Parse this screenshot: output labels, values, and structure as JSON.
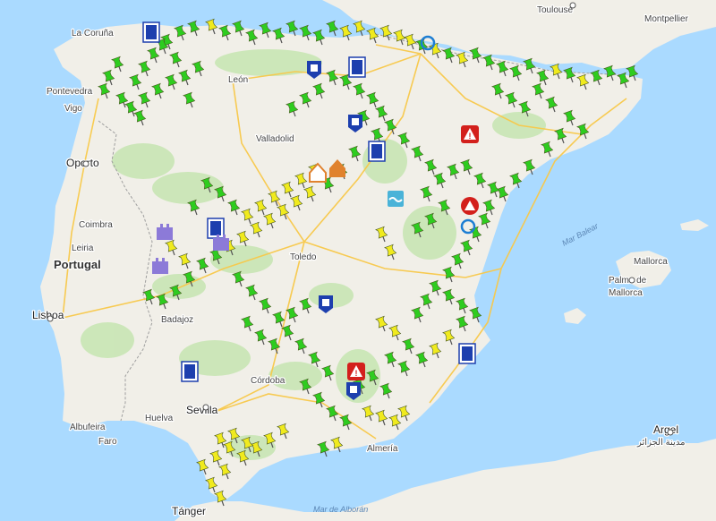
{
  "map": {
    "country_label": "Portugal",
    "cities": {
      "la_coruna": "La Coruña",
      "pontevedra": "Pontevedra",
      "vigo": "Vigo",
      "oporto": "Oporto",
      "coimbra": "Coimbra",
      "leiria": "Leiria",
      "lisboa": "Lisboa",
      "badajoz": "Badajoz",
      "albufeira": "Albufeira",
      "faro": "Faro",
      "huelva": "Huelva",
      "sevilla": "Sevilla",
      "cordoba": "Córdoba",
      "tanger": "Tánger",
      "leon": "León",
      "valladolid": "Valladolid",
      "toledo": "Toledo",
      "almeria": "Almería",
      "toulouse": "Toulouse",
      "montpellier": "Montpellier",
      "mallorca": "Mallorca",
      "palma": "Palma de",
      "palma2": "Mallorca",
      "argel": "Argel",
      "argel_ar": "مدينة الجزائر"
    },
    "seas": {
      "balear": "Mar Balear",
      "alboran": "Mar de Alborán"
    },
    "colors": {
      "water": "#aadaff",
      "land": "#f1efe8",
      "park": "#c8e6b4",
      "highway": "#f8c94a",
      "road": "#ffffff",
      "border": "#9e9e9e",
      "pin_green": "#2ecc1f",
      "pin_yellow": "#f0ea1e",
      "marker_blue": "#1d3fae",
      "marker_red": "#d3201c",
      "marker_purple": "#8c7ad8"
    }
  }
}
